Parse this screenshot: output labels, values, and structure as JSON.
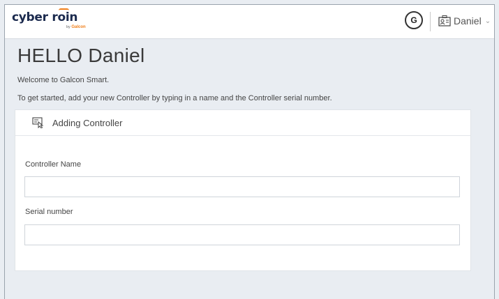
{
  "header": {
    "logo_text_1": "cyber r",
    "logo_text_accent": "oi",
    "logo_text_2": "n",
    "logo_sub_by": "by",
    "logo_sub_brand": "Galcon",
    "support_icon_text": "G",
    "user_name": "Daniel"
  },
  "page": {
    "title": "HELLO Daniel",
    "welcome": "Welcome to Galcon Smart.",
    "instructions": "To get started, add your new Controller by typing in a name and the Controller serial number."
  },
  "card": {
    "title": "Adding Controller",
    "controller_name_label": "Controller Name",
    "controller_name_value": "",
    "serial_label": "Serial number",
    "serial_value": ""
  },
  "colors": {
    "accent": "#f07e19",
    "logo": "#1b2a4e",
    "background": "#e9edf2"
  }
}
